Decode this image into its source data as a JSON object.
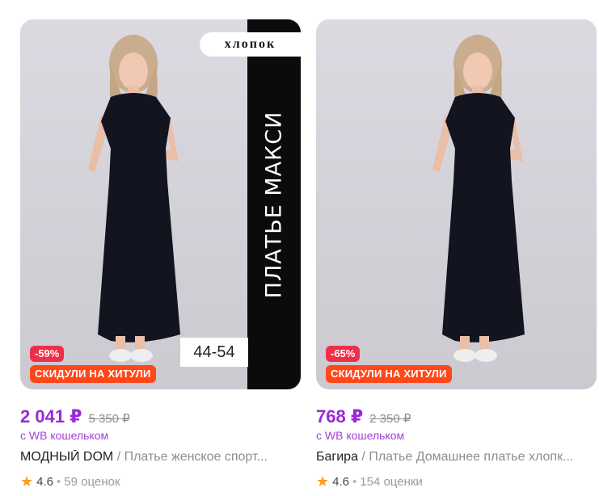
{
  "products": [
    {
      "photo": {
        "badge_text": "хлопок",
        "vertical_text": "ПЛАТЬЕ МАКСИ",
        "size_label": "44-54"
      },
      "discount": "-59%",
      "promo": "СКИДУЛИ НА ХИТУЛИ",
      "price_current": "2 041 ₽",
      "price_old": "5 350 ₽",
      "wallet_note": "с WB кошельком",
      "brand": "МОДНЫЙ DOM",
      "separator": " / ",
      "name": "Платье женское спорт...",
      "rating": "4.6",
      "reviews": "59 оценок"
    },
    {
      "discount": "-65%",
      "promo": "СКИДУЛИ НА ХИТУЛИ",
      "price_current": "768 ₽",
      "price_old": "2 350 ₽",
      "wallet_note": "с WB кошельком",
      "brand": "Багира",
      "separator": " / ",
      "name": "Платье Домашнее платье хлопк...",
      "rating": "4.6",
      "reviews": "154 оценки"
    }
  ],
  "colors": {
    "price": "#9a29d8",
    "wallet": "#a13fd8",
    "discount_badge": "#f12e4a",
    "promo_badge": "#ff4719",
    "star": "#ff9c20"
  },
  "icons": {
    "rating": "star-icon",
    "rating_separator": "dot"
  }
}
